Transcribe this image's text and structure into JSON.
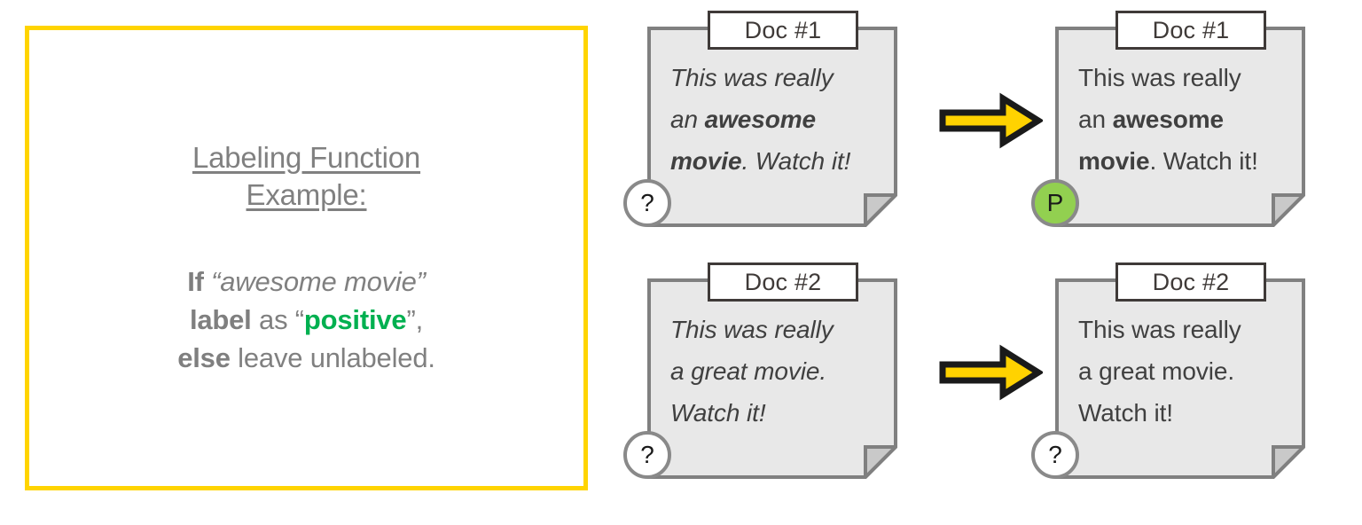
{
  "panel": {
    "title_line1": "Labeling Function",
    "title_line2": "Example:",
    "rule_line1_kw": "If",
    "rule_line1_quoted": "“awesome movie”",
    "rule_line2_kw": "label",
    "rule_line2_mid": "as",
    "rule_line2_open_quote": "“",
    "rule_line2_value": "positive",
    "rule_line2_close_quote": "”,",
    "rule_line3_kw": "else",
    "rule_line3_rest": "leave unlabeled.",
    "border_color": "#FFD400",
    "text_color": "#808080",
    "accent_green": "#00B050"
  },
  "rows": [
    {
      "before": {
        "tab_label": "Doc #1",
        "badge_label": "?",
        "badge_kind": "unlabeled",
        "badge_color": "#FFFFFF",
        "italic": true,
        "lines": [
          [
            {
              "t": "This was really",
              "bold": false
            }
          ],
          [
            {
              "t": "an ",
              "bold": false
            },
            {
              "t": "awesome",
              "bold": true
            }
          ],
          [
            {
              "t": "movie",
              "bold": true
            },
            {
              "t": ". Watch it!",
              "bold": false
            }
          ]
        ]
      },
      "arrow": {
        "name": "yellow-right-arrow",
        "fill": "#FFD200",
        "stroke": "#1A1A1A"
      },
      "after": {
        "tab_label": "Doc #1",
        "badge_label": "P",
        "badge_kind": "positive",
        "badge_color": "#92D050",
        "italic": false,
        "lines": [
          [
            {
              "t": "This was really",
              "bold": false
            }
          ],
          [
            {
              "t": "an ",
              "bold": false
            },
            {
              "t": "awesome",
              "bold": true
            }
          ],
          [
            {
              "t": "movie",
              "bold": true
            },
            {
              "t": ". Watch it!",
              "bold": false
            }
          ]
        ]
      }
    },
    {
      "before": {
        "tab_label": "Doc #2",
        "badge_label": "?",
        "badge_kind": "unlabeled",
        "badge_color": "#FFFFFF",
        "italic": true,
        "lines": [
          [
            {
              "t": "This was really",
              "bold": false
            }
          ],
          [
            {
              "t": "a great movie.",
              "bold": false
            }
          ],
          [
            {
              "t": "Watch it!",
              "bold": false
            }
          ]
        ]
      },
      "arrow": {
        "name": "yellow-right-arrow",
        "fill": "#FFD200",
        "stroke": "#1A1A1A"
      },
      "after": {
        "tab_label": "Doc #2",
        "badge_label": "?",
        "badge_kind": "unlabeled",
        "badge_color": "#FFFFFF",
        "italic": false,
        "lines": [
          [
            {
              "t": "This was really",
              "bold": false
            }
          ],
          [
            {
              "t": "a great movie.",
              "bold": false
            }
          ],
          [
            {
              "t": "Watch it!",
              "bold": false
            }
          ]
        ]
      }
    }
  ],
  "card_style": {
    "fill": "#E8E8E8",
    "border": "#808080",
    "fold_fill": "#C9C9C9",
    "text_color": "#404040"
  }
}
